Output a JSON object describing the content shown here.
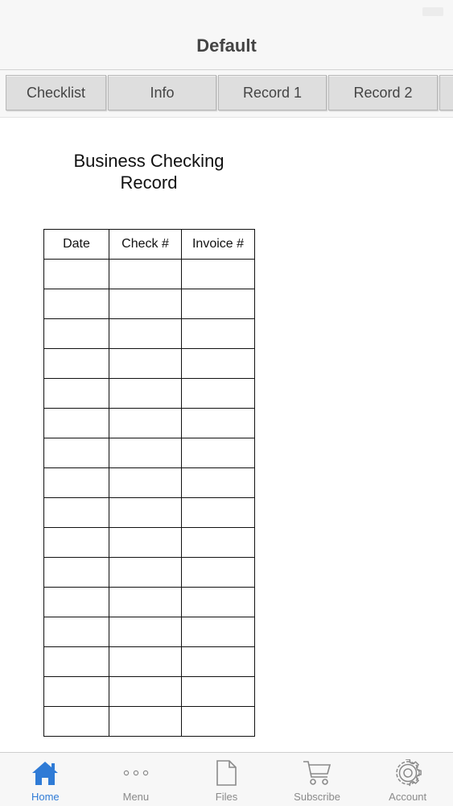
{
  "status_bar": {
    "carrier": "",
    "time": ""
  },
  "nav": {
    "title": "Default"
  },
  "tabs": [
    {
      "label": "Checklist"
    },
    {
      "label": "Info"
    },
    {
      "label": "Record 1"
    },
    {
      "label": "Record 2"
    },
    {
      "label": ""
    }
  ],
  "document": {
    "title": "Business Checking Record",
    "table": {
      "columns": [
        "Date",
        "Check #",
        "Invoice #"
      ],
      "rows": [
        [
          "",
          "",
          ""
        ],
        [
          "",
          "",
          ""
        ],
        [
          "",
          "",
          ""
        ],
        [
          "",
          "",
          ""
        ],
        [
          "",
          "",
          ""
        ],
        [
          "",
          "",
          ""
        ],
        [
          "",
          "",
          ""
        ],
        [
          "",
          "",
          ""
        ],
        [
          "",
          "",
          ""
        ],
        [
          "",
          "",
          ""
        ],
        [
          "",
          "",
          ""
        ],
        [
          "",
          "",
          ""
        ],
        [
          "",
          "",
          ""
        ],
        [
          "",
          "",
          ""
        ],
        [
          "",
          "",
          ""
        ],
        [
          "",
          "",
          ""
        ]
      ]
    }
  },
  "tab_bar": {
    "items": [
      {
        "label": "Home",
        "icon": "home-icon",
        "active": true
      },
      {
        "label": "Menu",
        "icon": "more-dots-icon",
        "active": false
      },
      {
        "label": "Files",
        "icon": "file-icon",
        "active": false
      },
      {
        "label": "Subscribe",
        "icon": "cart-icon",
        "active": false
      },
      {
        "label": "Account",
        "icon": "gear-icon",
        "active": false
      }
    ]
  },
  "colors": {
    "accent": "#2f7bd6",
    "inactive": "#8a8a8a",
    "bar_background": "#f7f7f7",
    "tab_background": "#dedede"
  }
}
